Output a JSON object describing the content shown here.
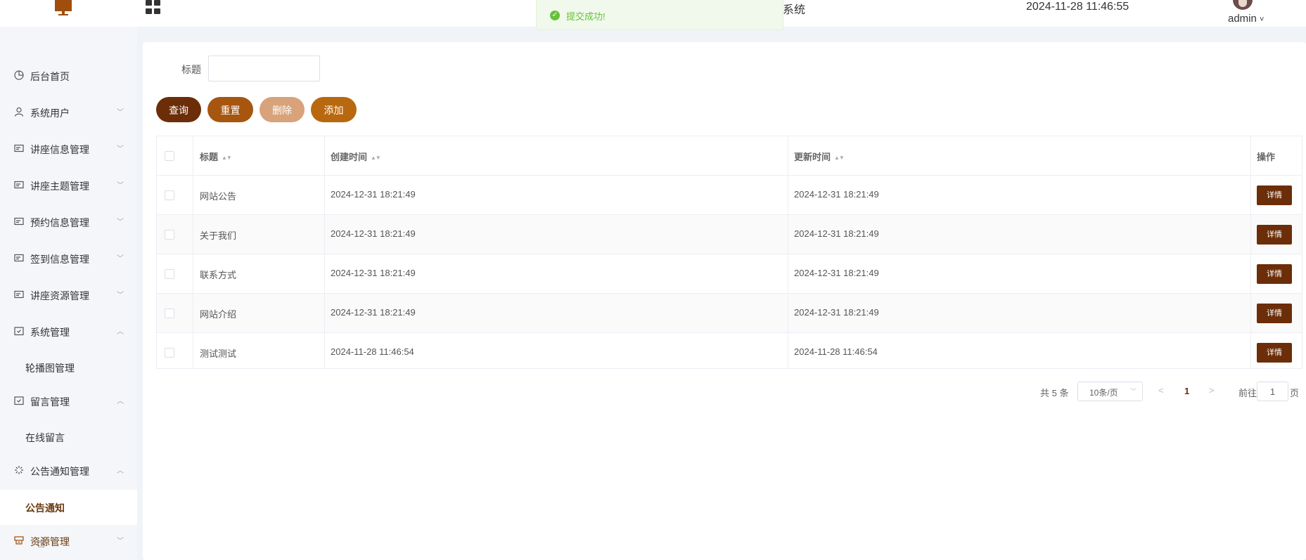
{
  "header": {
    "title": "系统",
    "datetime": "2024-11-28 11:46:55",
    "user": "admin",
    "user_caret": "˅"
  },
  "toast": {
    "message": "提交成功!",
    "icon": "check-circle-icon",
    "color": "#67c23a"
  },
  "sidebar": {
    "items": [
      {
        "label": "后台首页",
        "icon": "clock-icon"
      },
      {
        "label": "系统用户",
        "icon": "user-icon"
      },
      {
        "label": "讲座信息管理",
        "icon": "card-icon"
      },
      {
        "label": "讲座主题管理",
        "icon": "card-icon"
      },
      {
        "label": "预约信息管理",
        "icon": "card-icon"
      },
      {
        "label": "签到信息管理",
        "icon": "card-icon"
      },
      {
        "label": "讲座资源管理",
        "icon": "card-icon"
      },
      {
        "label": "系统管理",
        "icon": "folder-check-icon",
        "sub": "轮播图管理"
      },
      {
        "label": "留言管理",
        "icon": "folder-check-icon",
        "sub": "在线留言"
      },
      {
        "label": "公告通知管理",
        "icon": "loading-icon",
        "sub": "公告通知"
      },
      {
        "label": "资源管理",
        "icon": "resource-icon"
      }
    ]
  },
  "search": {
    "label": "标题",
    "value": ""
  },
  "buttons": {
    "query": "查询",
    "reset": "重置",
    "delete": "删除",
    "add": "添加"
  },
  "table": {
    "columns": [
      "标题",
      "创建时间",
      "更新时间",
      "操作"
    ],
    "rows": [
      {
        "title": "网站公告",
        "created": "2024-12-31 18:21:49",
        "updated": "2024-12-31 18:21:49",
        "action": "详情"
      },
      {
        "title": "关于我们",
        "created": "2024-12-31 18:21:49",
        "updated": "2024-12-31 18:21:49",
        "action": "详情"
      },
      {
        "title": "联系方式",
        "created": "2024-12-31 18:21:49",
        "updated": "2024-12-31 18:21:49",
        "action": "详情"
      },
      {
        "title": "网站介绍",
        "created": "2024-12-31 18:21:49",
        "updated": "2024-12-31 18:21:49",
        "action": "详情"
      },
      {
        "title": "测试测试",
        "created": "2024-11-28 11:46:54",
        "updated": "2024-11-28 11:46:54",
        "action": "详情"
      }
    ]
  },
  "pagination": {
    "total": "共 5 条",
    "page_size": "10条/页",
    "current": "1",
    "goto_label": "前往",
    "goto_value": "1",
    "page_suffix": "页"
  },
  "colors": {
    "accent": "#6b2e08",
    "reset": "#a6560f",
    "delete": "#d8a27a",
    "add": "#b8680f"
  }
}
